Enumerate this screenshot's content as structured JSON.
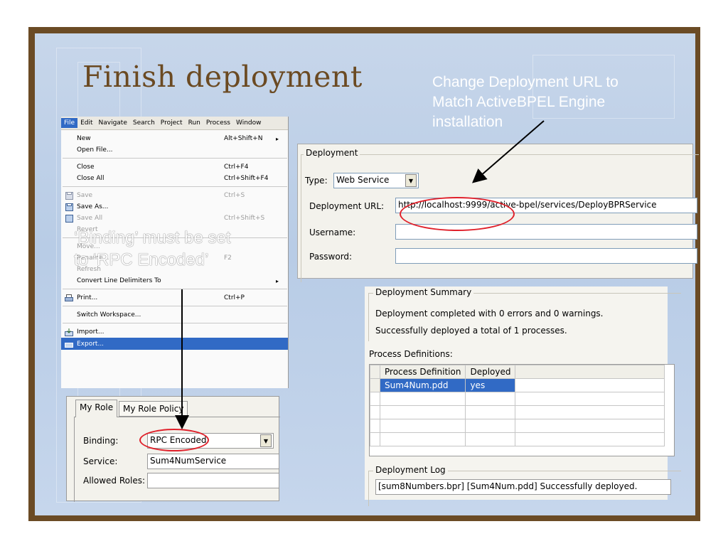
{
  "title": "Finish deployment",
  "note_url": [
    "Change Deployment URL to",
    "Match ActiveBPEL Engine",
    "installation"
  ],
  "note_binding": [
    "‘Binding’ must be set",
    "to ‘RPC Encoded’"
  ],
  "menubar": [
    "File",
    "Edit",
    "Navigate",
    "Search",
    "Project",
    "Run",
    "Process",
    "Window"
  ],
  "menu_items": [
    {
      "label": "New",
      "shortcut": "Alt+Shift+N",
      "arrow": "▸"
    },
    {
      "label": "Open File...",
      "shortcut": ""
    },
    {
      "label": "Close",
      "shortcut": "Ctrl+F4"
    },
    {
      "label": "Close All",
      "shortcut": "Ctrl+Shift+F4"
    },
    {
      "label": "Save",
      "shortcut": "Ctrl+S"
    },
    {
      "label": "Save As...",
      "shortcut": ""
    },
    {
      "label": "Save All",
      "shortcut": "Ctrl+Shift+S"
    },
    {
      "label": "Revert",
      "shortcut": ""
    },
    {
      "label": "Move...",
      "shortcut": ""
    },
    {
      "label": "Rename...",
      "shortcut": "F2"
    },
    {
      "label": "Refresh",
      "shortcut": ""
    },
    {
      "label": "Convert Line Delimiters To",
      "shortcut": "",
      "arrow": "▸"
    },
    {
      "label": "Print...",
      "shortcut": "Ctrl+P"
    },
    {
      "label": "Switch Workspace...",
      "shortcut": ""
    },
    {
      "label": "Import...",
      "shortcut": ""
    },
    {
      "label": "Export...",
      "shortcut": ""
    }
  ],
  "deployment": {
    "legend": "Deployment",
    "type_label": "Type:",
    "type_value": "Web Service",
    "url_label": "Deployment URL:",
    "url_value": "http://localhost:9999/active-bpel/services/DeployBPRService",
    "username_label": "Username:",
    "username_value": "",
    "password_label": "Password:",
    "password_value": ""
  },
  "summary": {
    "legend": "Deployment Summary",
    "line1": "Deployment completed with 0 errors and 0 warnings.",
    "line2": "Successfully deployed a total of 1 processes.",
    "defs_label": "Process Definitions:",
    "col_process": "Process Definition",
    "col_deployed": "Deployed",
    "row_process": "Sum4Num.pdd",
    "row_deployed": "yes",
    "log_legend": "Deployment Log",
    "log_text": "[sum8Numbers.bpr] [Sum4Num.pdd] Successfully deployed."
  },
  "role": {
    "tab1": "My Role",
    "tab2": "My Role Policy",
    "binding_label": "Binding:",
    "binding_value": "RPC Encoded",
    "service_label": "Service:",
    "service_value": "Sum4NumService",
    "roles_label": "Allowed Roles:",
    "roles_value": ""
  },
  "colors": {
    "frame": "#6b4b25",
    "title": "#6b4a22",
    "highlight": "#e0202a",
    "selection": "#316ac5"
  }
}
